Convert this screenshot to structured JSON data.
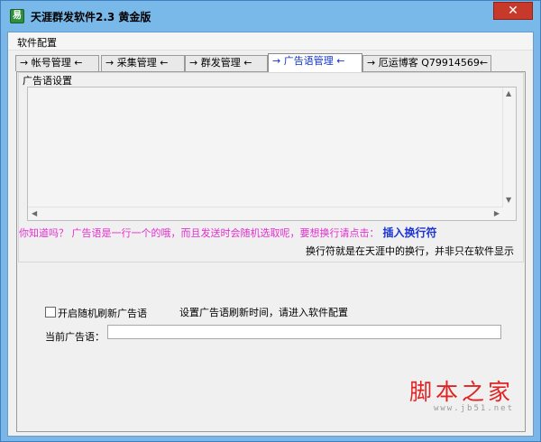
{
  "window": {
    "title": "天涯群发软件2.3 黄金版",
    "icon_glyph": "易",
    "close_glyph": "✕",
    "titlebar_color": "#79b9ea",
    "close_color": "#c7392b"
  },
  "menu": {
    "items": [
      "软件配置"
    ]
  },
  "tabs": [
    {
      "label": "→ 帐号管理 ←",
      "active": false
    },
    {
      "label": "→ 采集管理 ←",
      "active": false
    },
    {
      "label": "→ 群发管理 ←",
      "active": false
    },
    {
      "label": "→ 广告语管理 ←",
      "active": true
    },
    {
      "label": "→ 厄运博客  Q79914569←",
      "active": false
    }
  ],
  "ad_settings": {
    "group_title": "广告语设置",
    "textarea_value": "",
    "tip_text": "你知道吗？ 广告语是一行一个的哦，而且发送时会随机选取呢，要想换行请点击：",
    "insert_link": "插入换行符",
    "note": "换行符就是在天涯中的换行，并非只在软件显示"
  },
  "options": {
    "random_refresh_label": "开启随机刷新广告语",
    "random_refresh_checked": false,
    "refresh_note": "设置广告语刷新时间，请进入软件配置",
    "current_ad_label": "当前广告语：",
    "current_ad_value": ""
  },
  "watermark": {
    "text": "脚本之家",
    "url": "www.jb51.net"
  },
  "colors": {
    "tip_color": "#e52ed1",
    "link_color": "#1c34d0",
    "active_tab_color": "#1233c8",
    "watermark_color": "#e02424"
  }
}
